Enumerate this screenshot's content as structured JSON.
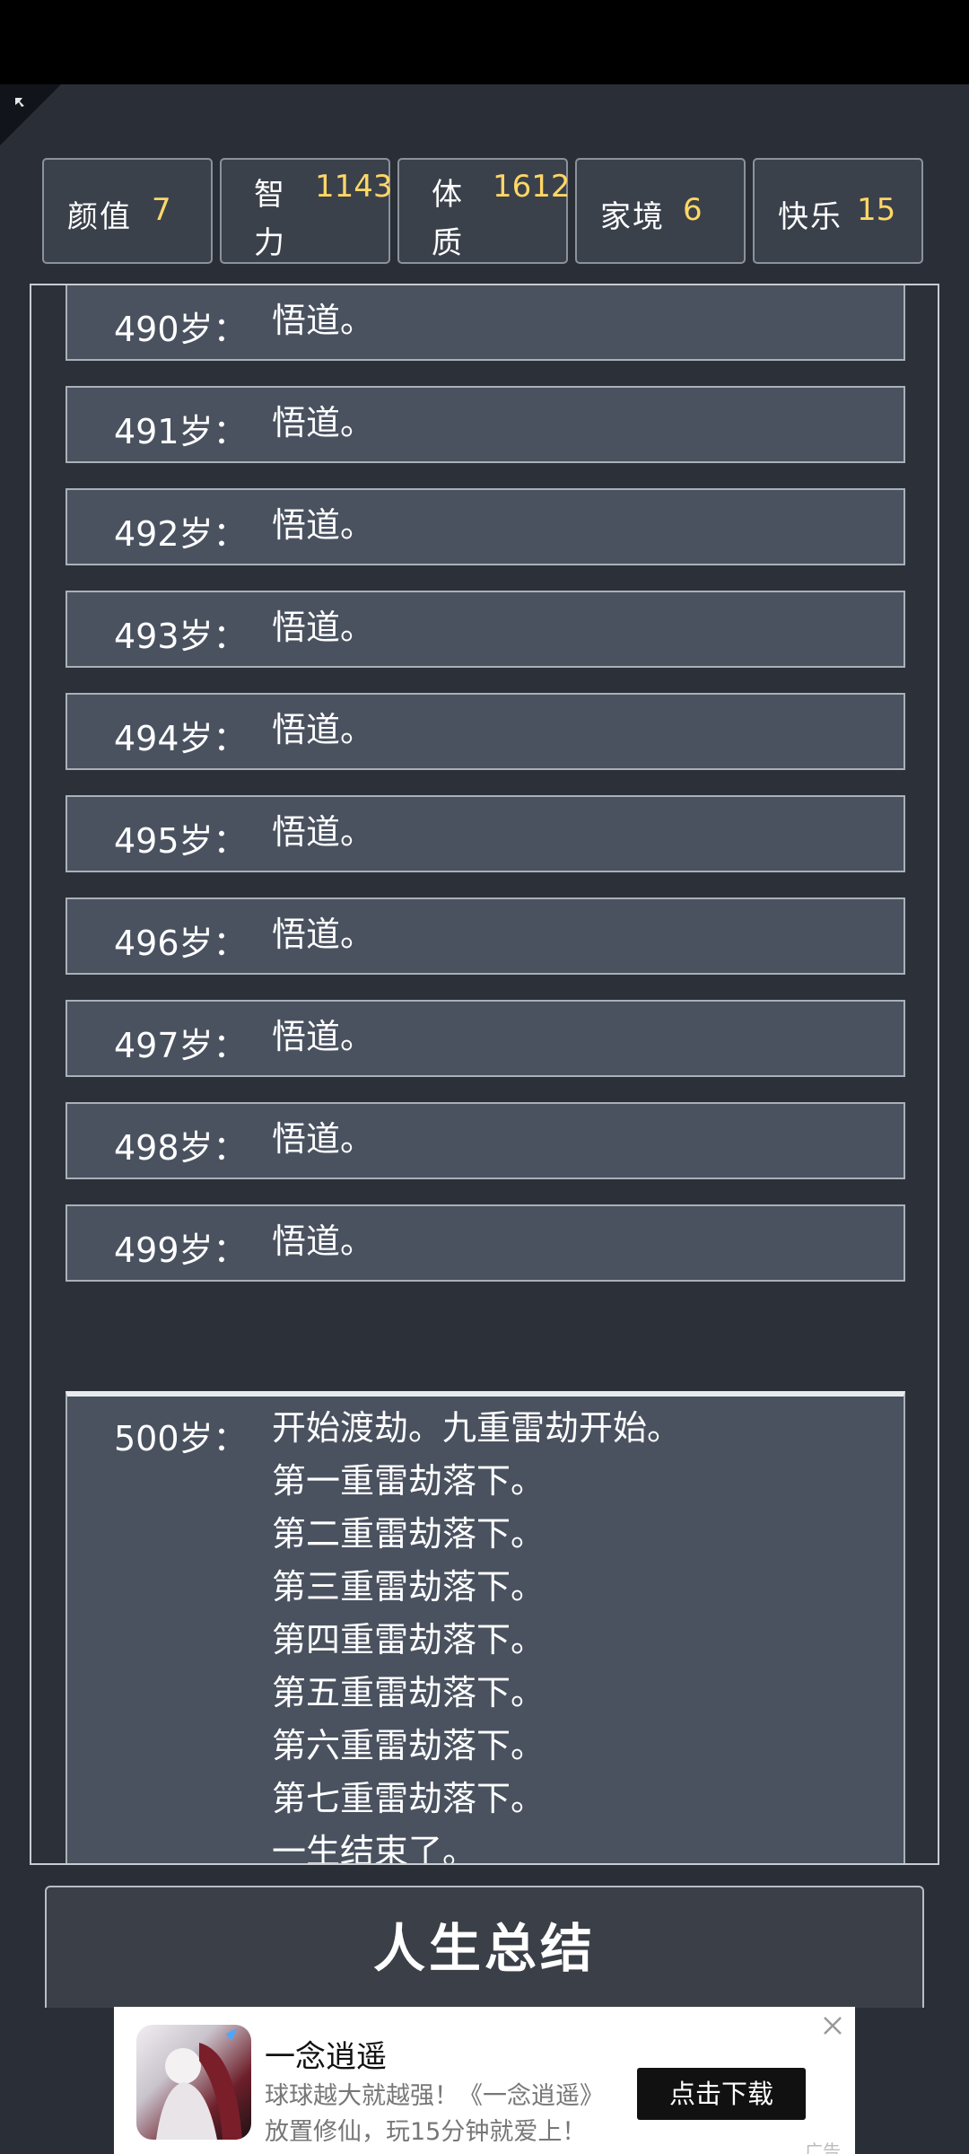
{
  "stats": [
    {
      "label": "颜值",
      "value": "7"
    },
    {
      "label": "智力",
      "value": "1143"
    },
    {
      "label": "体质",
      "value": "1612"
    },
    {
      "label": "家境",
      "value": "6"
    },
    {
      "label": "快乐",
      "value": "15"
    }
  ],
  "log": [
    {
      "age": "490岁：",
      "text": "悟道。"
    },
    {
      "age": "491岁：",
      "text": "悟道。"
    },
    {
      "age": "492岁：",
      "text": "悟道。"
    },
    {
      "age": "493岁：",
      "text": "悟道。"
    },
    {
      "age": "494岁：",
      "text": "悟道。"
    },
    {
      "age": "495岁：",
      "text": "悟道。"
    },
    {
      "age": "496岁：",
      "text": "悟道。"
    },
    {
      "age": "497岁：",
      "text": "悟道。"
    },
    {
      "age": "498岁：",
      "text": "悟道。"
    },
    {
      "age": "499岁：",
      "text": "悟道。"
    },
    {
      "age": "500岁：",
      "text": "开始渡劫。九重雷劫开始。\n第一重雷劫落下。\n第二重雷劫落下。\n第三重雷劫落下。\n第四重雷劫落下。\n第五重雷劫落下。\n第六重雷劫落下。\n第七重雷劫落下。\n一生结束了。"
    }
  ],
  "summary_button": "人生总结",
  "ad": {
    "title": "一念逍遥",
    "desc_line1": "球球越大就越强！《一念逍遥》",
    "desc_line2": "放置修仙，玩15分钟就爱上！",
    "button": "点击下载",
    "tag": "广告"
  },
  "colors": {
    "value_highlight": "#ffd766",
    "panel_bg": "#2a2f37",
    "row_bg": "#4a5260"
  }
}
